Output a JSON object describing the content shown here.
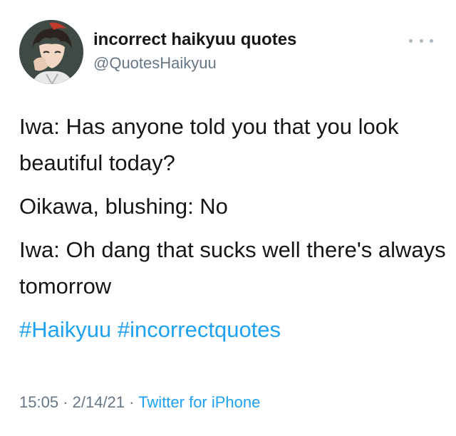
{
  "author": {
    "display_name": "incorrect haikyuu quotes",
    "handle": "@QuotesHaikyuu"
  },
  "tweet": {
    "lines": [
      "Iwa: Has anyone told you that you look beautiful today?",
      "Oikawa, blushing: No",
      "Iwa: Oh dang that sucks well there's always tomorrow"
    ],
    "hashtags": "#Haikyuu #incorrectquotes"
  },
  "meta": {
    "time": "15:05",
    "sep1": " · ",
    "date": "2/14/21",
    "sep2": " · ",
    "source": "Twitter for iPhone"
  },
  "icons": {
    "avatar": "anime-character-avatar",
    "more": "more-options-icon"
  },
  "colors": {
    "link": "#1da1f2",
    "secondary_text": "#657786",
    "primary_text": "#14171a"
  }
}
